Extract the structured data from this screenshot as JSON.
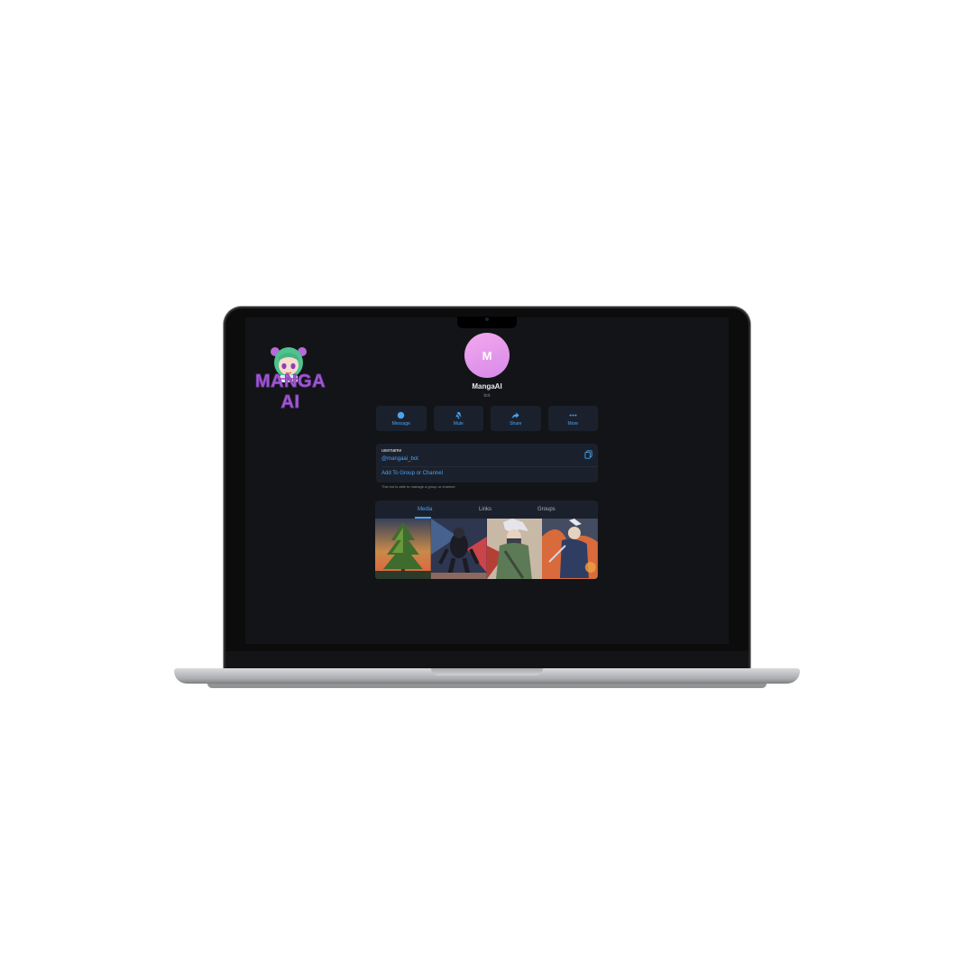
{
  "brand": {
    "title": "MANGA AI"
  },
  "profile": {
    "avatar_initial": "M",
    "name": "MangaAI",
    "subtitle": "bot"
  },
  "actions": [
    {
      "label": "Message",
      "icon": "chat-bubble-icon"
    },
    {
      "label": "Mute",
      "icon": "bell-mute-icon"
    },
    {
      "label": "Share",
      "icon": "share-arrow-icon"
    },
    {
      "label": "More",
      "icon": "more-dots-icon"
    }
  ],
  "info": {
    "key": "username",
    "value": "@mangaai_bot",
    "link": "Add To Group or Channel",
    "note": "This bot is able to manage a group or channel."
  },
  "tabs": [
    {
      "label": "Media",
      "active": true
    },
    {
      "label": "Links",
      "active": false
    },
    {
      "label": "Groups",
      "active": false
    }
  ],
  "media": [
    {
      "name": "pine-tree-sunset"
    },
    {
      "name": "dark-armored-warrior"
    },
    {
      "name": "silver-haired-ninja"
    },
    {
      "name": "ninja-fire-battle"
    }
  ],
  "colors": {
    "accent": "#4aa2f0",
    "screen_bg": "#131417",
    "card_bg": "#1b212c",
    "avatar_gradient": [
      "#f4a8ee",
      "#d68ae8"
    ],
    "brand_purple": "#a35ed2"
  }
}
